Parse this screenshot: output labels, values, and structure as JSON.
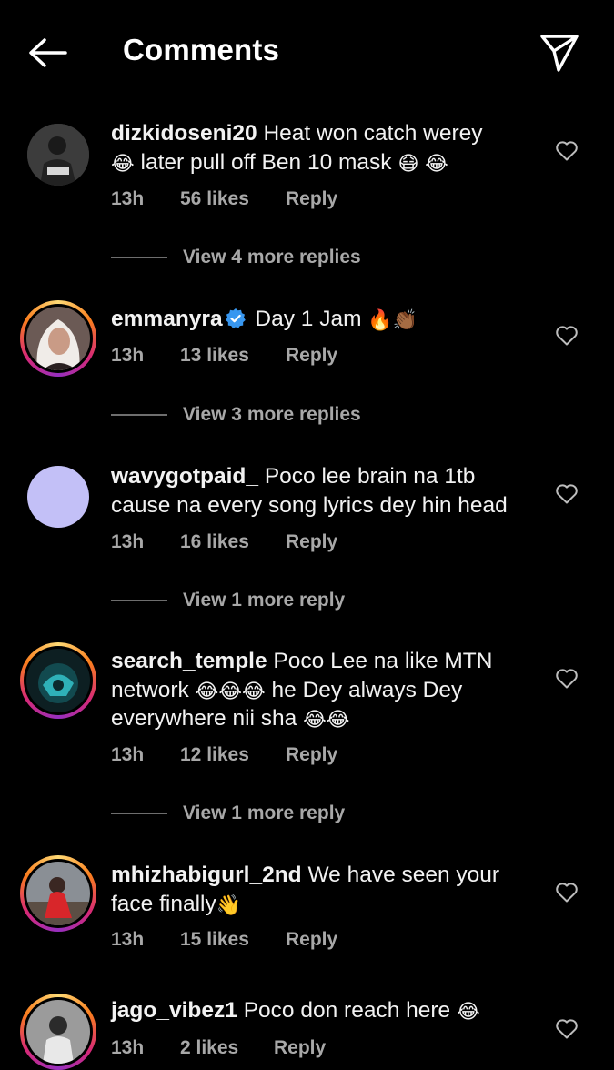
{
  "header": {
    "title": "Comments"
  },
  "comments": [
    {
      "username": "dizkidoseni20",
      "text_a": "Heat won catch werey",
      "emoji_a": "😂",
      "text_b": "later pull off Ben 10 mask",
      "emoji_b": "😷",
      "emoji_c": "😂",
      "time": "13h",
      "likes": "56 likes",
      "reply": "Reply",
      "view_more": "View 4 more replies"
    },
    {
      "username": "emmanyra",
      "text_a": "Day 1 Jam",
      "emoji_a": "🔥",
      "emoji_b": "👏🏾",
      "time": "13h",
      "likes": "13 likes",
      "reply": "Reply",
      "view_more": "View 3 more replies"
    },
    {
      "username": "wavygotpaid_",
      "text_a": "Poco lee brain na 1tb cause na every song lyrics dey hin head",
      "time": "13h",
      "likes": "16 likes",
      "reply": "Reply",
      "view_more": "View 1 more reply"
    },
    {
      "username": "search_temple",
      "text_a": "Poco Lee na like MTN network",
      "emoji_a": "😂😂😂",
      "text_b": "he Dey always Dey everywhere nii sha",
      "emoji_b": "😂😂",
      "time": "13h",
      "likes": "12 likes",
      "reply": "Reply",
      "view_more": "View 1 more reply"
    },
    {
      "username": "mhizhabigurl_2nd",
      "text_a": "We have seen your face finally",
      "emoji_a": "👋",
      "time": "13h",
      "likes": "15 likes",
      "reply": "Reply"
    },
    {
      "username": "jago_vibez1",
      "text_a": "Poco don reach here",
      "emoji_a": "😂",
      "time": "13h",
      "likes": "2 likes",
      "reply": "Reply"
    }
  ],
  "colors": {
    "background": "#000000",
    "meta_text": "#a8a8a8",
    "verified": "#3897f0",
    "avatar_placeholder": "#c3c0f7"
  },
  "icons": [
    "back-arrow-icon",
    "send-icon",
    "verified-icon",
    "heart-icon"
  ]
}
